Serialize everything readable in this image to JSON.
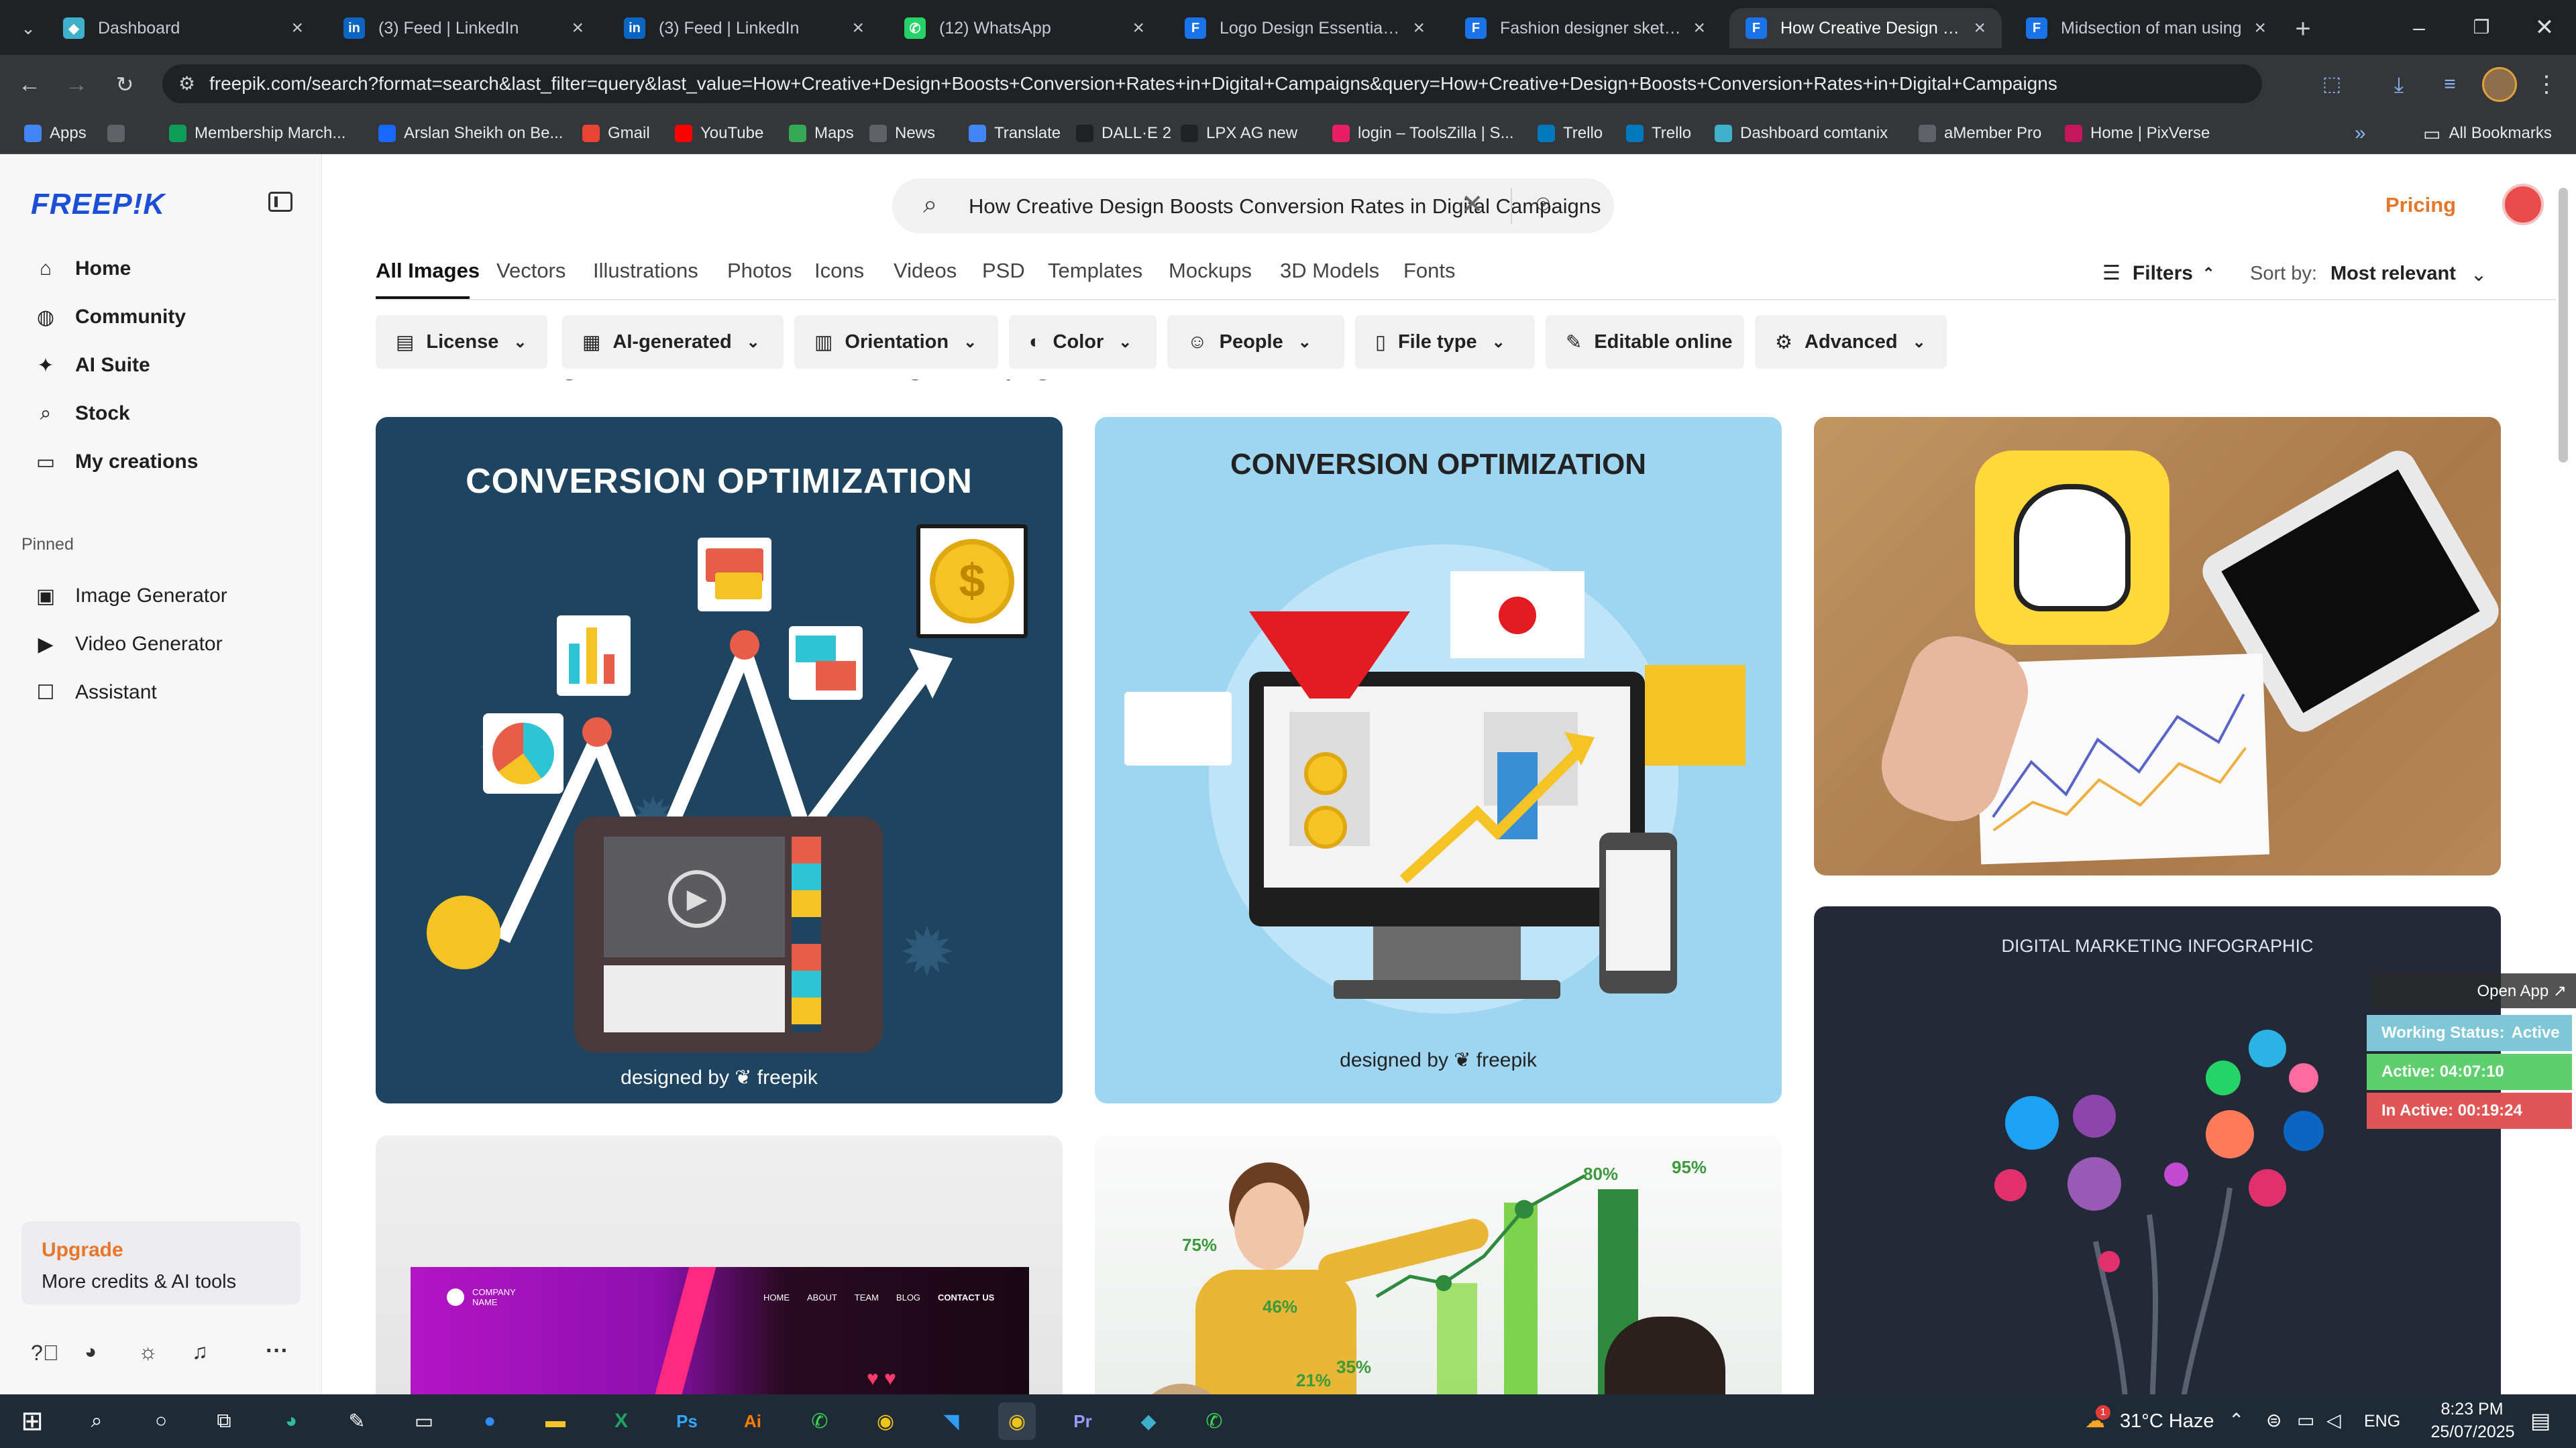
{
  "browser": {
    "tabs": [
      {
        "title": "Dashboard",
        "icon": "dashboard-icon",
        "color": "#3fb0c9",
        "glyph": "◆"
      },
      {
        "title": "(3) Feed | LinkedIn",
        "icon": "linkedin-icon",
        "color": "#0a66c2",
        "glyph": "in"
      },
      {
        "title": "(3) Feed | LinkedIn",
        "icon": "linkedin-icon",
        "color": "#0a66c2",
        "glyph": "in"
      },
      {
        "title": "(12) WhatsApp",
        "icon": "whatsapp-icon",
        "color": "#25d366",
        "glyph": "✆"
      },
      {
        "title": "Logo Design Essentials: W",
        "icon": "freepik-icon",
        "color": "#1a73e8",
        "glyph": "F"
      },
      {
        "title": "Fashion designer sketch o",
        "icon": "freepik-icon",
        "color": "#1a73e8",
        "glyph": "F"
      },
      {
        "title": "How Creative Design Boo",
        "icon": "freepik-icon",
        "color": "#1a73e8",
        "glyph": "F"
      },
      {
        "title": "Midsection of man using",
        "icon": "freepik-icon",
        "color": "#1a73e8",
        "glyph": "F"
      }
    ],
    "new_tab": "+",
    "url": "freepik.com/search?format=search&last_filter=query&last_value=How+Creative+Design+Boosts+Conversion+Rates+in+Digital+Campaigns&query=How+Creative+Design+Boosts+Conversion+Rates+in+Digital+Campaigns",
    "bookmarks": [
      {
        "label": "Apps",
        "color": "#4285f4"
      },
      {
        "label": "",
        "color": "#5f6368"
      },
      {
        "label": "Membership March...",
        "color": "#0f9d58"
      },
      {
        "label": "Arslan Sheikh on Be...",
        "color": "#1769ff"
      },
      {
        "label": "Gmail",
        "color": "#ea4335"
      },
      {
        "label": "YouTube",
        "color": "#ff0000"
      },
      {
        "label": "Maps",
        "color": "#34a853"
      },
      {
        "label": "News",
        "color": "#5f6368"
      },
      {
        "label": "Translate",
        "color": "#4285f4"
      },
      {
        "label": "DALL·E 2",
        "color": "#202124"
      },
      {
        "label": "LPX AG new",
        "color": "#202124"
      },
      {
        "label": "login – ToolsZilla | S...",
        "color": "#e91e63"
      },
      {
        "label": "Trello",
        "color": "#0079bf"
      },
      {
        "label": "Trello",
        "color": "#0079bf"
      },
      {
        "label": "Dashboard comtanix",
        "color": "#3fb0c9"
      },
      {
        "label": "aMember Pro",
        "color": "#5f6368"
      },
      {
        "label": "Home | PixVerse",
        "color": "#c2185b"
      }
    ],
    "all_bookmarks": "All Bookmarks"
  },
  "sidebar": {
    "logo": "FREEP!K",
    "nav": [
      {
        "label": "Home",
        "icon": "home-icon",
        "glyph": "⌂"
      },
      {
        "label": "Community",
        "icon": "globe-icon",
        "glyph": "◍"
      },
      {
        "label": "AI Suite",
        "icon": "sparkle-icon",
        "glyph": "✦"
      },
      {
        "label": "Stock",
        "icon": "search-icon",
        "glyph": "⌕"
      },
      {
        "label": "My creations",
        "icon": "folder-icon",
        "glyph": "▭"
      }
    ],
    "pinned_label": "Pinned",
    "pinned": [
      {
        "label": "Image Generator",
        "icon": "image-icon",
        "glyph": "▣"
      },
      {
        "label": "Video Generator",
        "icon": "video-icon",
        "glyph": "▶"
      },
      {
        "label": "Assistant",
        "icon": "chat-icon",
        "glyph": "☐"
      }
    ],
    "upgrade": {
      "title": "Upgrade",
      "subtitle": "More credits & AI tools"
    }
  },
  "header": {
    "search_value": "How Creative Design Boosts Conversion Rates in Digital Campaigns",
    "pricing": "Pricing"
  },
  "categories": [
    "All Images",
    "Vectors",
    "Illustrations",
    "Photos",
    "Icons",
    "Videos",
    "PSD",
    "Templates",
    "Mockups",
    "3D Models",
    "Fonts"
  ],
  "filters_label": "Filters",
  "sort_label": "Sort by:",
  "sort_value": "Most relevant",
  "chips": [
    {
      "label": "License",
      "icon": "license-icon",
      "glyph": "▤"
    },
    {
      "label": "AI-generated",
      "icon": "ai-icon",
      "glyph": "▦"
    },
    {
      "label": "Orientation",
      "icon": "orientation-icon",
      "glyph": "▥"
    },
    {
      "label": "Color",
      "icon": "palette-icon",
      "glyph": "◐"
    },
    {
      "label": "People",
      "icon": "people-icon",
      "glyph": "☺"
    },
    {
      "label": "File type",
      "icon": "file-icon",
      "glyph": "▯"
    },
    {
      "label": "Editable online",
      "icon": "pen-icon",
      "glyph": "✎"
    },
    {
      "label": "Advanced",
      "icon": "gear-icon",
      "glyph": "⚙"
    }
  ],
  "results_heading": "How Creative Design Boosts Conversion Rates in Digital Campaigns",
  "cards": {
    "card1_title": "CONVERSION OPTIMIZATION",
    "card1_credit": "designed by ❦ freepik",
    "card2_title": "CONVERSION OPTIMIZATION",
    "card2_credit": "designed by ❦ freepik",
    "card4_title": "DIGITAL MARKETING INFOGRAPHIC",
    "card5_brand": "COMPANY NAME",
    "card5_nav": [
      "HOME",
      "ABOUT",
      "TEAM",
      "BLOG",
      "CONTACT US"
    ],
    "card6_pcts": [
      "80%",
      "95%",
      "75%",
      "46%",
      "35%",
      "21%"
    ]
  },
  "overlay": {
    "open_app": "Open App ↗",
    "working_label": "Working Status:",
    "working_value": "Active",
    "active": "Active: 04:07:10",
    "inactive": "In Active: 00:19:24"
  },
  "taskbar": {
    "weather": "31°C Haze",
    "lang": "ENG",
    "time": "8:23 PM",
    "date": "25/07/2025",
    "notif_count": "1"
  }
}
